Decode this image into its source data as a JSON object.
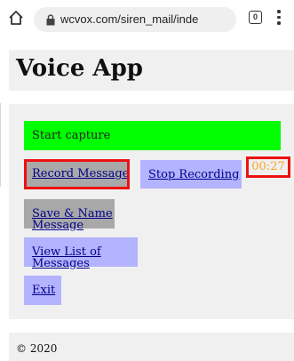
{
  "browser": {
    "url": "wcvox.com/siren_mail/inde",
    "tab_count": "0",
    "icons": [
      "home-icon",
      "lock-icon",
      "tabs-icon",
      "menu-icon"
    ]
  },
  "header": {
    "title": "Voice App"
  },
  "controls": {
    "start_capture": "Start capture",
    "record_message": "Record Message",
    "stop_recording": "Stop Recording",
    "timer": "00:27",
    "save_name": "Save & Name Message",
    "view_list": "View List of Messages",
    "exit": "Exit"
  },
  "footer": {
    "copyright": "© 2020"
  },
  "colors": {
    "start_bg": "#00ff00",
    "gray_button": "#a8a8a8",
    "blue_button": "#b3b3ff",
    "highlight_border": "#ee1111",
    "timer_text": "#f5a623",
    "link_text": "#00008b"
  }
}
